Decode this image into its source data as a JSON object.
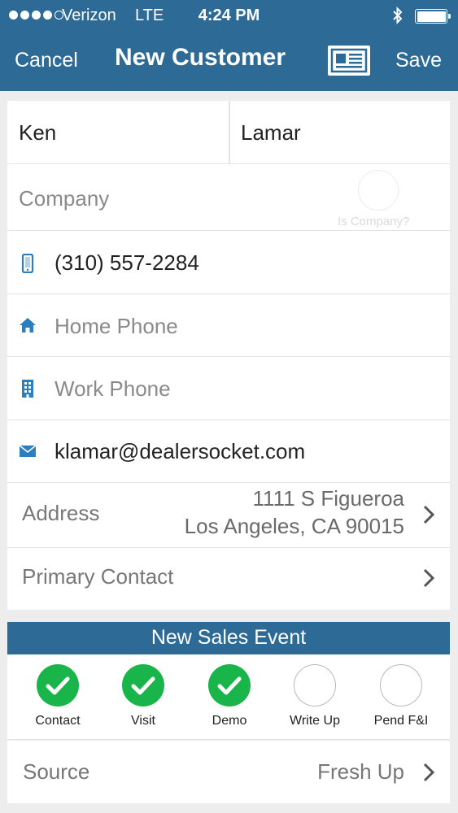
{
  "status_bar": {
    "carrier": "Verizon",
    "network": "LTE",
    "time": "4:24 PM"
  },
  "nav": {
    "cancel": "Cancel",
    "title": "New Customer",
    "save": "Save",
    "scan_icon": "business-card-icon"
  },
  "form": {
    "first_name": "Ken",
    "last_name": "Lamar",
    "company_placeholder": "Company",
    "is_company_label": "Is Company?",
    "mobile_phone": "(310) 557-2284",
    "home_phone_placeholder": "Home Phone",
    "work_phone_placeholder": "Work Phone",
    "email": "klamar@dealersocket.com",
    "address_label": "Address",
    "address_line1": "1111 S Figueroa",
    "address_line2": "Los Angeles, CA 90015",
    "primary_contact_label": "Primary Contact"
  },
  "sales_event": {
    "header": "New Sales Event",
    "steps": [
      {
        "label": "Contact",
        "done": true
      },
      {
        "label": "Visit",
        "done": true
      },
      {
        "label": "Demo",
        "done": true
      },
      {
        "label": "Write Up",
        "done": false
      },
      {
        "label": "Pend F&I",
        "done": false
      }
    ],
    "source_label": "Source",
    "source_value": "Fresh Up"
  },
  "colors": {
    "brand_blue": "#2d6a96",
    "icon_blue": "#2b7fc0",
    "check_green": "#1ab54a"
  }
}
